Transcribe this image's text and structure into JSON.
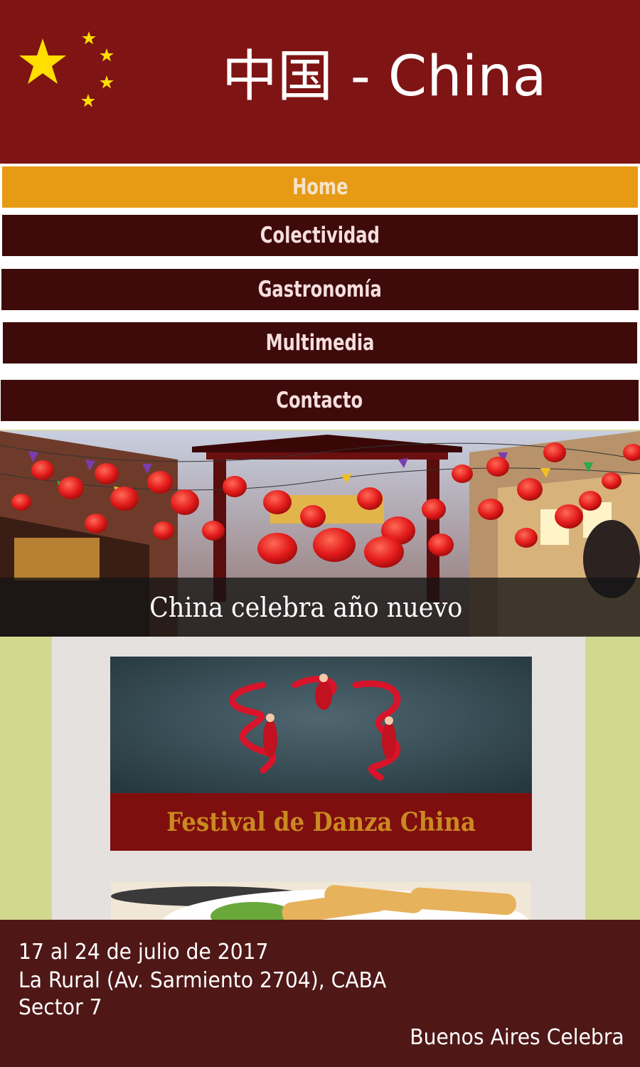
{
  "header": {
    "title": "中国 - China",
    "flag_icon": "china-flag-icon",
    "colors": {
      "background": "#7f1414",
      "stars": "#ffde00"
    }
  },
  "nav": {
    "items": [
      {
        "label": "Home",
        "active": true
      },
      {
        "label": "Colectividad"
      },
      {
        "label": "Gastronomía"
      },
      {
        "label": "Multimedia"
      },
      {
        "label": "Contacto"
      }
    ],
    "colors": {
      "active": "#e79a14",
      "default": "#3e0a0a"
    }
  },
  "hero": {
    "caption": "China celebra año nuevo"
  },
  "cards": [
    {
      "title": "Festival de Danza China"
    }
  ],
  "footer": {
    "lines": [
      "17 al 24 de julio de 2017",
      "La Rural (Av. Sarmiento 2704), CABA",
      "Sector 7"
    ],
    "brand": "Buenos Aires Celebra"
  }
}
